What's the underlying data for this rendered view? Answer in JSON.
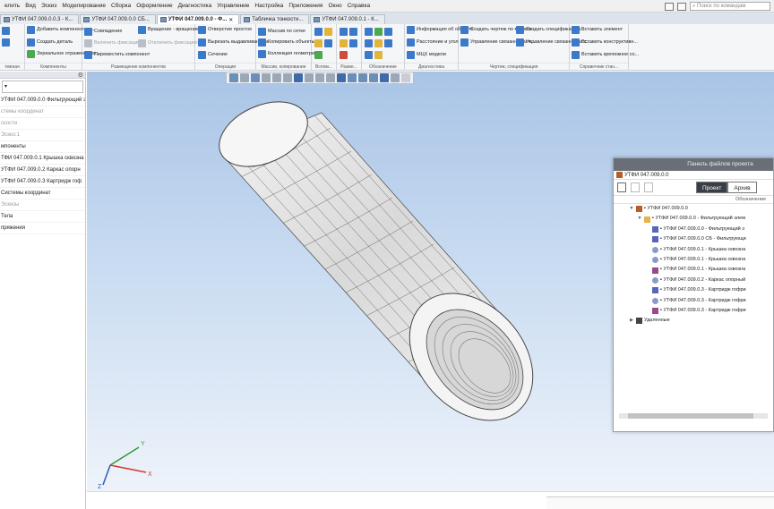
{
  "menu": {
    "items": [
      "елить",
      "Вид",
      "Эскиз",
      "Моделирование",
      "Сборка",
      "Оформление",
      "Диагностика",
      "Управление",
      "Настройка",
      "Приложения",
      "Окно",
      "Справка"
    ],
    "search_placeholder": "Поиск по командам"
  },
  "tabs": [
    {
      "label": "УТФИ 047.009.0.0.3 - К..."
    },
    {
      "label": "УТФИ 047.009.0.0 СБ..."
    },
    {
      "label": "УТФИ 047.009.0.0 - Ф..."
    },
    {
      "label": "Табличка тонкости..."
    },
    {
      "label": "УТФИ 047.009.0.1 - К..."
    }
  ],
  "ribbon": {
    "groups": [
      {
        "label": "тежная",
        "buttons": []
      },
      {
        "label": "Компоненты",
        "buttons": [
          "Добавить компонент из...",
          "Создать деталь",
          "Зеркальное отражение ко..."
        ]
      },
      {
        "label": "Размещение компонентов",
        "buttons": [
          "Совпадение",
          "Вращение - вращение",
          "Включить фиксацию",
          "Отключить фиксацию",
          "Переместить компонент"
        ]
      },
      {
        "label": "Операции",
        "buttons": [
          "Отверстие простое",
          "Вырезать выдавливанием",
          "Сечение"
        ]
      },
      {
        "label": "Массив, копирование",
        "buttons": [
          "Массив по сетке",
          "Копировать объекты",
          "Коллекция геометрии"
        ]
      },
      {
        "label": "Вспом...",
        "buttons": []
      },
      {
        "label": "Разме...",
        "buttons": []
      },
      {
        "label": "Обозначение",
        "buttons": []
      },
      {
        "label": "Диагностика",
        "buttons": [
          "Информация об объекте",
          "Расстояние и угол",
          "МЦХ модели"
        ]
      },
      {
        "label": "Чертеж, спецификация",
        "buttons": [
          "Создать чертеж по модели",
          "Управление связанными ч...",
          "Создать спецификацию...",
          "Управление связанными с..."
        ]
      },
      {
        "label": "Справочник стан...",
        "buttons": [
          "Вставить элемент",
          "Вставить конструктивн...",
          "Вставить крепежное со..."
        ]
      }
    ]
  },
  "left_panel": {
    "select_value": "",
    "items": [
      {
        "label": "УТФИ 047.009.0.0 Фильтрующий эл",
        "grey": false
      },
      {
        "label": "стемы координат",
        "grey": true
      },
      {
        "label": "скости",
        "grey": true
      },
      {
        "label": "Эскиз:1",
        "grey": true
      },
      {
        "label": "мпоненты",
        "grey": false
      },
      {
        "label": "ТФИ 047.009.0.1 Крышка сквозна",
        "grey": false
      },
      {
        "label": "УТФИ 047.009.0.2 Каркас опорн",
        "grey": false
      },
      {
        "label": "УТФИ 047.009.0.3 Картридж гоф",
        "grey": false
      },
      {
        "label": "Системы координат",
        "grey": false
      },
      {
        "label": "Эскизы",
        "grey": true
      },
      {
        "label": "Тела",
        "grey": false
      },
      {
        "label": "пряжения",
        "grey": false
      }
    ]
  },
  "project_panel": {
    "title": "Панель файлов проекта",
    "path": "УТФИ 047.009.0.0",
    "btn_project": "Проект",
    "btn_archive": "Архив",
    "column": "Обозначение",
    "rows": [
      {
        "indent": 1,
        "arrow": "▼",
        "icon": "asm",
        "text": "▪ УТФИ 047.009.0.0"
      },
      {
        "indent": 2,
        "arrow": "▼",
        "icon": "folder",
        "text": "▪ УТФИ 047.009.0.0 - Фильтрующий элем"
      },
      {
        "indent": 3,
        "arrow": "",
        "icon": "dwg",
        "text": "▪ УТФИ 047.009.0.0 - Фильтрующий э"
      },
      {
        "indent": 3,
        "arrow": "",
        "icon": "dwg",
        "text": "▪ УТФИ 047.009.0.0 СБ - Фильтрующи"
      },
      {
        "indent": 3,
        "arrow": "",
        "icon": "part",
        "text": "▪ УТФИ 047.009.0.1 - Крышка сквозна"
      },
      {
        "indent": 3,
        "arrow": "",
        "icon": "part",
        "text": "▪ УТФИ 047.009.0.1 - Крышка сквозна"
      },
      {
        "indent": 3,
        "arrow": "",
        "icon": "spec",
        "text": "▪ УТФИ 047.009.0.1 - Крышка сквозна"
      },
      {
        "indent": 3,
        "arrow": "",
        "icon": "part",
        "text": "▪ УТФИ 047.009.0.2 - Каркас опорный"
      },
      {
        "indent": 3,
        "arrow": "",
        "icon": "dwg",
        "text": "▪ УТФИ 047.009.0.3 - Картридж гофри"
      },
      {
        "indent": 3,
        "arrow": "",
        "icon": "part",
        "text": "▪ УТФИ 047.009.0.3 - Картридж гофри"
      },
      {
        "indent": 3,
        "arrow": "",
        "icon": "spec",
        "text": "▪ УТФИ 047.009.0.3 - Картридж гофри"
      },
      {
        "indent": 1,
        "arrow": "▶",
        "icon": "trash",
        "text": "Удаленные"
      }
    ]
  },
  "axes": {
    "x": "X",
    "y": "Y",
    "z": "Z"
  }
}
